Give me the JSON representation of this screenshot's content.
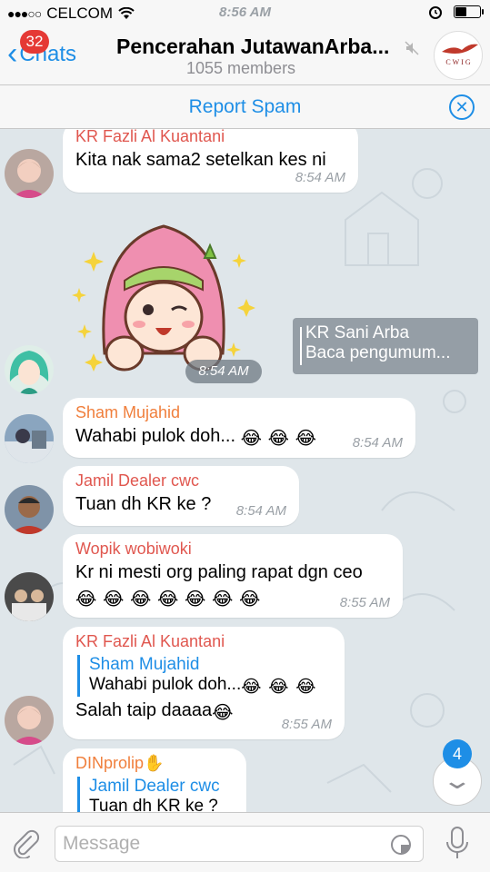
{
  "status_bar": {
    "carrier": "CELCOM",
    "time": "8:56 AM"
  },
  "nav": {
    "back_label": "Chats",
    "unread_badge": "32",
    "title": "Pencerahan JutawanArba...",
    "subtitle": "1055 members",
    "group_avatar_text": "CWIG"
  },
  "report_spam": {
    "label": "Report Spam"
  },
  "pinned": {
    "name": "KR Sani Arba",
    "text": "Baca pengumum..."
  },
  "messages": [
    {
      "sender": "KR Fazli Al Kuantani",
      "sender_color": "#e0574f",
      "text": "Kita nak sama2 setelkan kes ni",
      "time": "8:54 AM"
    },
    {
      "sticker": "hijab-girl-thumbs-up",
      "time": "8:54 AM"
    },
    {
      "sender": "Sham Mujahid",
      "sender_color": "#f07f3c",
      "text": "Wahabi pulok doh...",
      "time": "8:54 AM"
    },
    {
      "sender": "Jamil Dealer cwc",
      "sender_color": "#e0574f",
      "text": "Tuan dh KR ke ?",
      "time": "8:54 AM"
    },
    {
      "sender": "Wopik wobiwoki",
      "sender_color": "#e0574f",
      "text": "Kr ni mesti org paling rapat dgn ceo",
      "time": "8:55 AM"
    },
    {
      "sender": "KR Fazli Al Kuantani",
      "sender_color": "#e0574f",
      "reply": {
        "name": "Sham Mujahid",
        "text": "Wahabi pulok doh..."
      },
      "text": "Salah taip daaaa",
      "time": "8:55 AM"
    },
    {
      "sender": "DINprolip",
      "sender_color": "#f07f3c",
      "reply": {
        "name": "Jamil Dealer cwc",
        "text": "Tuan dh KR ke ?"
      }
    }
  ],
  "scroll_down": {
    "count": "4"
  },
  "input": {
    "placeholder": "Message"
  }
}
